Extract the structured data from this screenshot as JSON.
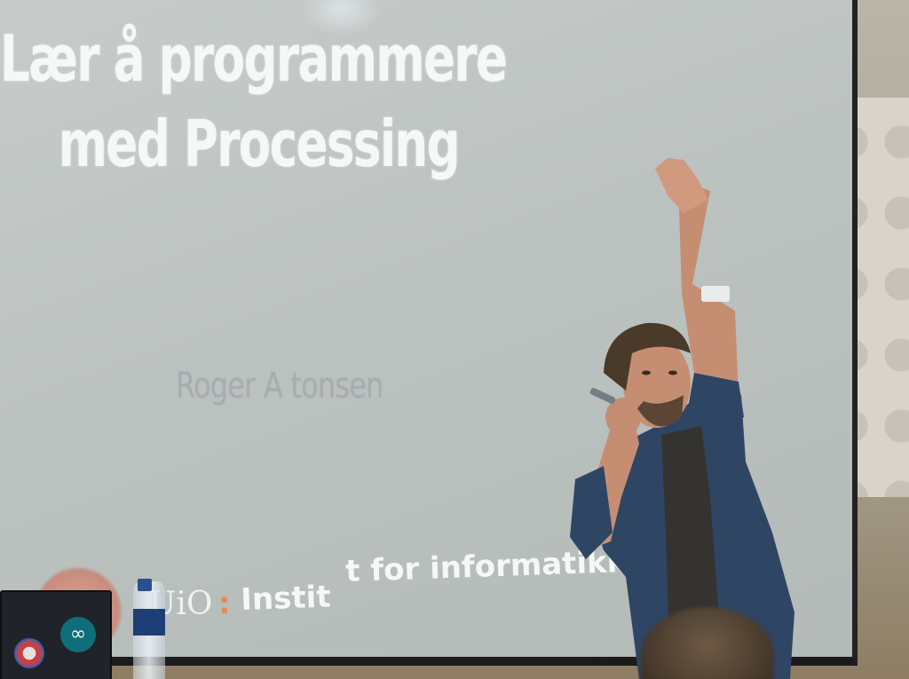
{
  "slide": {
    "title_line1": "Lær å programmere",
    "title_line2": "med Processing",
    "author": "Roger A  tonsen",
    "footer_uio": "UiO",
    "footer_colon": ":",
    "footer_institute_start": "Instit",
    "footer_institute_end": "t for informatikk"
  },
  "laptop": {
    "sticker_symbol": "∞"
  },
  "colors": {
    "slide_background": "#c3c8c6",
    "slide_text": "#f4f8f7",
    "author_text": "#a6abab",
    "uio_colon": "#e58a5f",
    "shirt": "#2f4564",
    "skin": "#c58e72",
    "hair": "#4a3a2a"
  }
}
